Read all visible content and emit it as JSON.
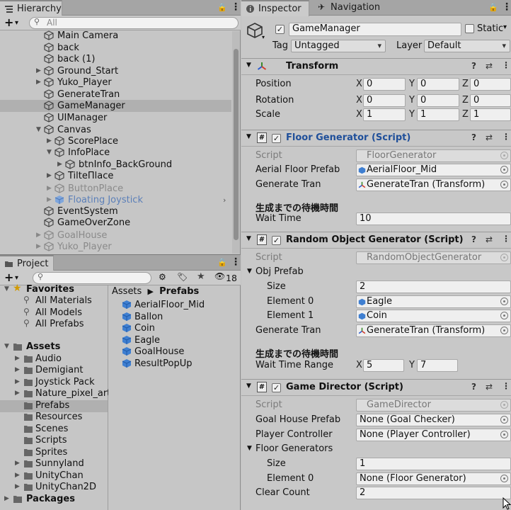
{
  "hierarchy": {
    "tab_label": "Hierarchy",
    "search_placeholder": "All",
    "items": [
      {
        "label": "Main Camera"
      },
      {
        "label": "back"
      },
      {
        "label": "back (1)"
      },
      {
        "label": "Ground_Start"
      },
      {
        "label": "Yuko_Player"
      },
      {
        "label": "GenerateTran"
      },
      {
        "label": "GameManager"
      },
      {
        "label": "UIManager"
      },
      {
        "label": "Canvas"
      },
      {
        "label": "ScorePlace"
      },
      {
        "label": "InfoPlace"
      },
      {
        "label": "btnInfo_BackGround"
      },
      {
        "label": "TilteПlace"
      },
      {
        "label": "ButtonPlace"
      },
      {
        "label": "Floating Joystick"
      },
      {
        "label": "EventSystem"
      },
      {
        "label": "GameOverZone"
      },
      {
        "label": "GoalHouse"
      },
      {
        "label": "Yuko_Player"
      }
    ]
  },
  "project": {
    "tab_label": "Project",
    "hidden_count": "18",
    "favorites": {
      "label": "Favorites",
      "items": [
        {
          "label": "All Materials"
        },
        {
          "label": "All Models"
        },
        {
          "label": "All Prefabs"
        }
      ]
    },
    "assets": {
      "label": "Assets",
      "items": [
        {
          "label": "Audio"
        },
        {
          "label": "Demigiant"
        },
        {
          "label": "Joystick Pack"
        },
        {
          "label": "Nature_pixel_art_a"
        },
        {
          "label": "Prefabs"
        },
        {
          "label": "Resources"
        },
        {
          "label": "Scenes"
        },
        {
          "label": "Scripts"
        },
        {
          "label": "Sprites"
        },
        {
          "label": "Sunnyland"
        },
        {
          "label": "UnityChan"
        },
        {
          "label": "UnityChan2D"
        }
      ]
    },
    "packages_label": "Packages",
    "breadcrumb": {
      "root": "Assets",
      "current": "Prefabs"
    },
    "prefabs": [
      {
        "label": "AerialFloor_Mid"
      },
      {
        "label": "Ballon"
      },
      {
        "label": "Coin"
      },
      {
        "label": "Eagle"
      },
      {
        "label": "GoalHouse"
      },
      {
        "label": "ResultPopUp"
      }
    ]
  },
  "inspector": {
    "tab_label": "Inspector",
    "nav_tab_label": "Navigation",
    "object_name": "GameManager",
    "static_label": "Static",
    "tag_label": "Tag",
    "tag_value": "Untagged",
    "layer_label": "Layer",
    "layer_value": "Default",
    "transform": {
      "title": "Transform",
      "position_label": "Position",
      "rotation_label": "Rotation",
      "scale_label": "Scale",
      "x": "X",
      "y": "Y",
      "z": "Z",
      "position": [
        "0",
        "0",
        "0"
      ],
      "rotation": [
        "0",
        "0",
        "0"
      ],
      "scale": [
        "1",
        "1",
        "1"
      ]
    },
    "floor_generator": {
      "title": "Floor Generator (Script)",
      "script_label": "Script",
      "script_value": "FloorGenerator",
      "prefab_label": "Aerial Floor Prefab",
      "prefab_value": "AerialFloor_Mid",
      "gen_label": "Generate Tran",
      "gen_value": "GenerateTran (Transform)",
      "section": "生成までの待機時間",
      "wait_label": "Wait Time",
      "wait_value": "10"
    },
    "random_generator": {
      "title": "Random Object Generator (Script)",
      "script_label": "Script",
      "script_value": "RandomObjectGenerator",
      "obj_prefab_label": "Obj Prefab",
      "size_label": "Size",
      "size_value": "2",
      "el0_label": "Element 0",
      "el0_value": "Eagle",
      "el1_label": "Element 1",
      "el1_value": "Coin",
      "gen_label": "Generate Tran",
      "gen_value": "GenerateTran (Transform)",
      "section": "生成までの待機時間",
      "range_label": "Wait Time Range",
      "range_x": "5",
      "range_y": "7"
    },
    "game_director": {
      "title": "Game Director (Script)",
      "script_label": "Script",
      "script_value": "GameDirector",
      "goal_label": "Goal House Prefab",
      "goal_value": "None (Goal Checker)",
      "player_label": "Player Controller",
      "player_value": "None (Player Controller)",
      "floor_gens_label": "Floor Generators",
      "size_label": "Size",
      "size_value": "1",
      "el0_label": "Element 0",
      "el0_value": "None (Floor Generator)",
      "clear_label": "Clear Count",
      "clear_value": "2"
    }
  }
}
